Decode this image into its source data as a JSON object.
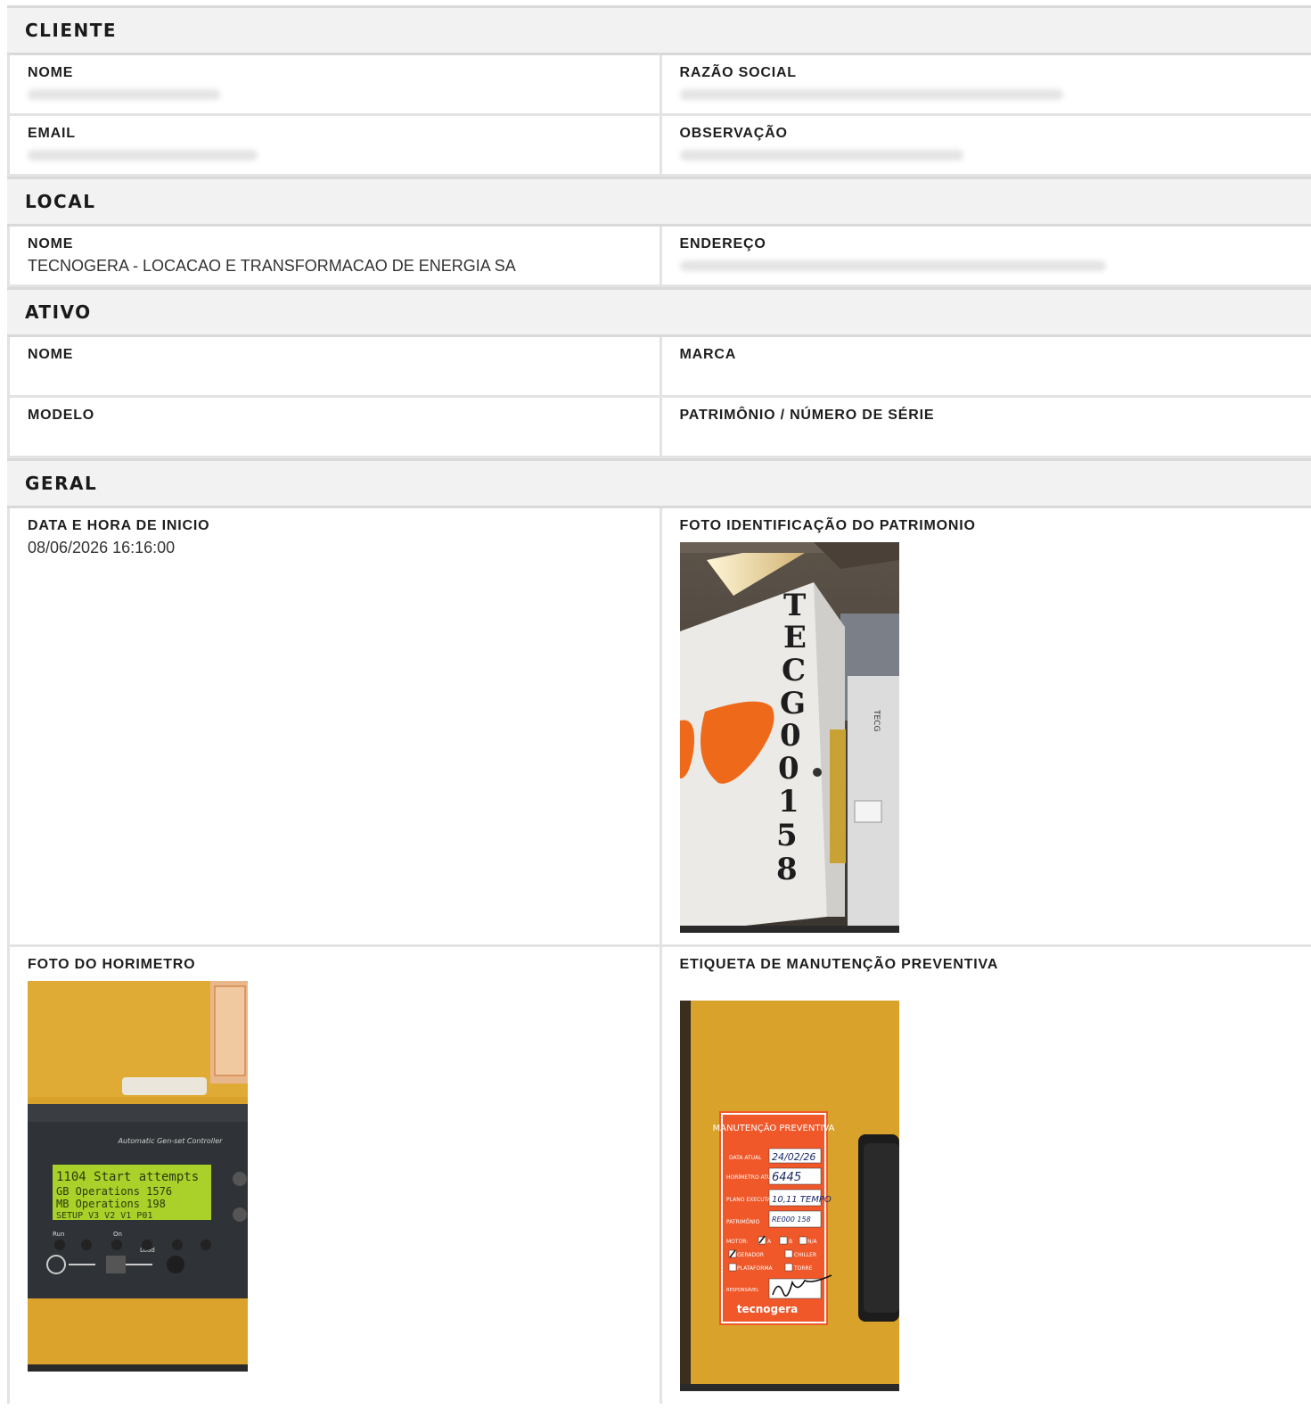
{
  "cliente": {
    "title": "CLIENTE",
    "nome_label": "NOME",
    "razao_label": "RAZÃO SOCIAL",
    "email_label": "EMAIL",
    "observacao_label": "OBSERVAÇÃO"
  },
  "local": {
    "title": "LOCAL",
    "nome_label": "NOME",
    "nome_value": "TECNOGERA - LOCACAO E TRANSFORMACAO DE ENERGIA SA",
    "endereco_label": "ENDEREÇO"
  },
  "ativo": {
    "title": "ATIVO",
    "nome_label": "NOME",
    "marca_label": "MARCA",
    "modelo_label": "MODELO",
    "patrimonio_label": "PATRIMÔNIO / NÚMERO DE SÉRIE"
  },
  "geral": {
    "title": "GERAL",
    "inicio_label": "DATA E HORA DE INICIO",
    "inicio_value": "08/06/2026 16:16:00",
    "foto_patrimonio_label": "FOTO IDENTIFICAÇÃO DO PATRIMONIO",
    "foto_horimetro_label": "FOTO DO HORIMETRO",
    "etiqueta_label": "ETIQUETA DE MANUTENÇÃO PREVENTIVA"
  },
  "photo_patrimonio": {
    "stencil": "TECG00158",
    "side_stencil": "TECG"
  },
  "photo_horimetro": {
    "panel_title": "Automatic Gen-set Controller",
    "lcd_line1": "1104 Start attempts",
    "lcd_line2": "GB Operations   1576",
    "lcd_line3": "MB Operations    198",
    "lcd_line4": "SETUP V3 V2 V1  P01",
    "btn_run": "Run",
    "btn_on": "On",
    "btn_load": "Load"
  },
  "photo_etiqueta": {
    "title": "MANUTENÇÃO PREVENTIVA",
    "data_atual_label": "DATA ATUAL",
    "data_atual_value": "24/02/26",
    "horimetro_label": "HORÍMETRO ATUAL",
    "horimetro_value": "6445",
    "plano_label": "PLANO EXECUTADO",
    "plano_value": "10,11 TEMPO",
    "patrimonio_label": "PATRIMÔNIO",
    "patrimonio_value": "RE000 158",
    "motor_label": "MOTOR:",
    "opt_a": "A",
    "opt_b": "B",
    "opt_na": "N/A",
    "opt_gerador": "GERADOR",
    "opt_chiller": "CHILLER",
    "opt_plataforma": "PLATAFORMA",
    "opt_torre": "TORRE",
    "responsavel_label": "RESPONSÁVEL",
    "brand": "tecnogera"
  }
}
